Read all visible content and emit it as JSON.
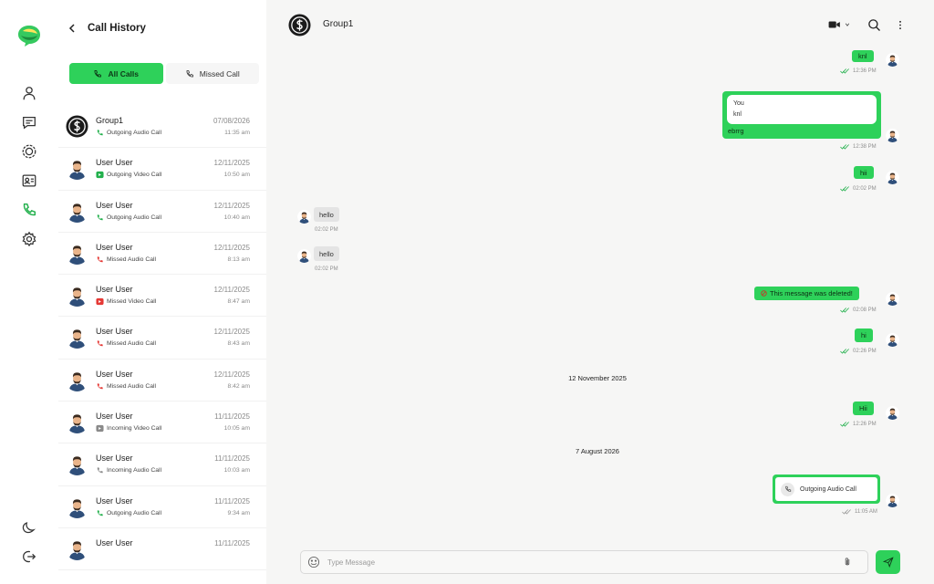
{
  "rail": {
    "items": [
      {
        "icon": "user-icon"
      },
      {
        "icon": "chat-icon"
      },
      {
        "icon": "status-icon"
      },
      {
        "icon": "contacts-icon"
      },
      {
        "icon": "phone-icon"
      },
      {
        "icon": "settings-icon"
      }
    ],
    "bottom": [
      {
        "icon": "moon-icon"
      },
      {
        "icon": "logout-icon"
      }
    ]
  },
  "panel": {
    "title": "Call History",
    "tabs": [
      {
        "label": "All Calls",
        "active": true
      },
      {
        "label": "Missed Call",
        "active": false
      }
    ],
    "calls": [
      {
        "name": "Group1",
        "type": "Outgoing Audio Call",
        "kind": "outgoing-audio",
        "date": "07/08/2026",
        "time": "11:35 am",
        "avatar": "group"
      },
      {
        "name": "User User",
        "type": "Outgoing Video Call",
        "kind": "outgoing-video",
        "date": "12/11/2025",
        "time": "10:50 am",
        "avatar": "user"
      },
      {
        "name": "User User",
        "type": "Outgoing Audio Call",
        "kind": "outgoing-audio",
        "date": "12/11/2025",
        "time": "10:40 am",
        "avatar": "user"
      },
      {
        "name": "User User",
        "type": "Missed Audio Call",
        "kind": "missed-audio",
        "date": "12/11/2025",
        "time": "8:13 am",
        "avatar": "user"
      },
      {
        "name": "User User",
        "type": "Missed Video Call",
        "kind": "missed-video",
        "date": "12/11/2025",
        "time": "8:47 am",
        "avatar": "user"
      },
      {
        "name": "User User",
        "type": "Missed Audio Call",
        "kind": "missed-audio",
        "date": "12/11/2025",
        "time": "8:43 am",
        "avatar": "user"
      },
      {
        "name": "User User",
        "type": "Missed Audio Call",
        "kind": "missed-audio",
        "date": "12/11/2025",
        "time": "8:42 am",
        "avatar": "user"
      },
      {
        "name": "User User",
        "type": "Incoming Video Call",
        "kind": "incoming-video",
        "date": "11/11/2025",
        "time": "10:05 am",
        "avatar": "user"
      },
      {
        "name": "User User",
        "type": "Incoming Audio Call",
        "kind": "incoming-audio",
        "date": "11/11/2025",
        "time": "10:03 am",
        "avatar": "user"
      },
      {
        "name": "User User",
        "type": "Outgoing Audio Call",
        "kind": "outgoing-audio",
        "date": "11/11/2025",
        "time": "9:34 am",
        "avatar": "user"
      },
      {
        "name": "User User",
        "type": "",
        "kind": "",
        "date": "11/11/2025",
        "time": "",
        "avatar": "user"
      }
    ]
  },
  "chat": {
    "title": "Group1",
    "messages": [
      {
        "id": "m1",
        "text": "knl",
        "time": "12:36 PM"
      },
      {
        "id": "m2",
        "reply_name": "You",
        "reply_text": "knl",
        "text": "ebrrg",
        "time": "12:38 PM"
      },
      {
        "id": "m3",
        "text": "hii",
        "time": "02:02 PM"
      },
      {
        "id": "m4",
        "text": "hello",
        "time": "02:02 PM"
      },
      {
        "id": "m5",
        "text": "hello",
        "time": "02:02 PM"
      },
      {
        "id": "m6",
        "text": "This message was deleted!",
        "time": "02:08 PM"
      },
      {
        "id": "m7",
        "text": "hi",
        "time": "02:26 PM"
      },
      {
        "id": "m8",
        "text": "Hii",
        "time": "12:26 PM"
      },
      {
        "id": "m9",
        "text": "Outgoing Audio Call",
        "time": "11:05 AM"
      }
    ],
    "date_separators": [
      "12 November 2025",
      "7 August 2026"
    ],
    "composer": {
      "placeholder": "Type Message"
    }
  },
  "colors": {
    "accent": "#2ed15a",
    "missed": "#e53935",
    "chat_bg": "#f6f6f5"
  }
}
